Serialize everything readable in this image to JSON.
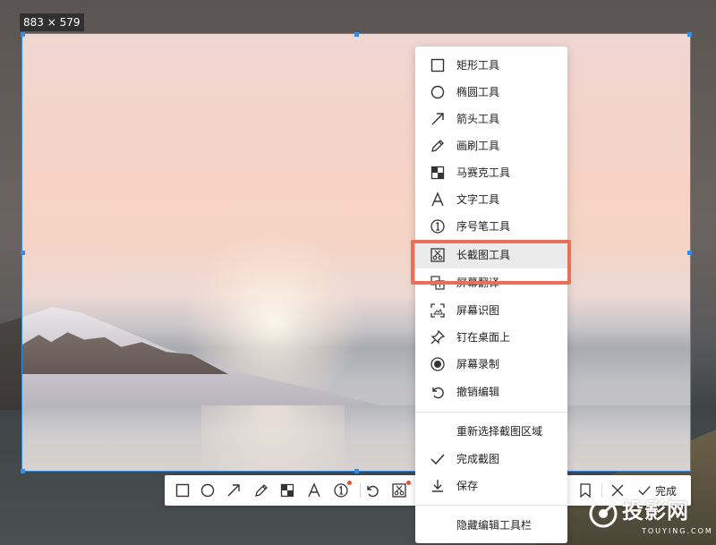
{
  "capture": {
    "size_label": "883 × 579"
  },
  "menu": {
    "items": [
      {
        "label": "矩形工具",
        "icon": "rectangle-icon"
      },
      {
        "label": "椭圆工具",
        "icon": "ellipse-icon"
      },
      {
        "label": "箭头工具",
        "icon": "arrow-icon"
      },
      {
        "label": "画刷工具",
        "icon": "pen-icon"
      },
      {
        "label": "马赛克工具",
        "icon": "mosaic-icon"
      },
      {
        "label": "文字工具",
        "icon": "text-icon"
      },
      {
        "label": "序号笔工具",
        "icon": "number-icon"
      },
      {
        "label": "长截图工具",
        "icon": "long-screenshot-icon",
        "highlighted": true
      },
      {
        "label": "屏幕翻译",
        "icon": "translate-icon"
      },
      {
        "label": "屏幕识图",
        "icon": "scan-image-icon"
      },
      {
        "label": "钉在桌面上",
        "icon": "pin-icon"
      },
      {
        "label": "屏幕录制",
        "icon": "record-icon"
      },
      {
        "label": "撤销编辑",
        "icon": "undo-icon"
      }
    ],
    "reselect_label": "重新选择截图区域",
    "finish_label": "完成截图",
    "save_label": "保存",
    "hide_toolbar_label": "隐藏编辑工具栏"
  },
  "toolbar": {
    "done_label": "完成"
  },
  "watermark": {
    "text": "投影网",
    "sub": "TOUYING.COM"
  },
  "colors": {
    "selection_border": "#3b8be0",
    "highlight_frame": "#e8705a",
    "badge_dot": "#e0553a"
  }
}
